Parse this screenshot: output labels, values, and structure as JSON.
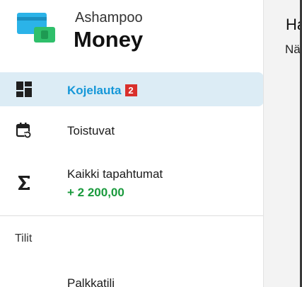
{
  "app": {
    "brand_small": "Ashampoo",
    "brand_large": "Money"
  },
  "sidebar": {
    "items": [
      {
        "label": "Kojelauta",
        "badge": "2",
        "icon": "dashboard-icon",
        "active": true
      },
      {
        "label": "Toistuvat",
        "icon": "calendar-repeat-icon"
      },
      {
        "label": "Kaikki tapahtumat",
        "amount": "+ 2 200,00",
        "icon": "sigma-icon"
      }
    ],
    "section_label": "Tilit",
    "accounts": [
      {
        "label": "Palkkatili"
      }
    ]
  },
  "main": {
    "title": "Ha",
    "subtitle": "Nä"
  },
  "colors": {
    "accent": "#1597d8",
    "active_bg": "#dcecf5",
    "badge": "#d9302c",
    "positive": "#1a9a3d"
  }
}
